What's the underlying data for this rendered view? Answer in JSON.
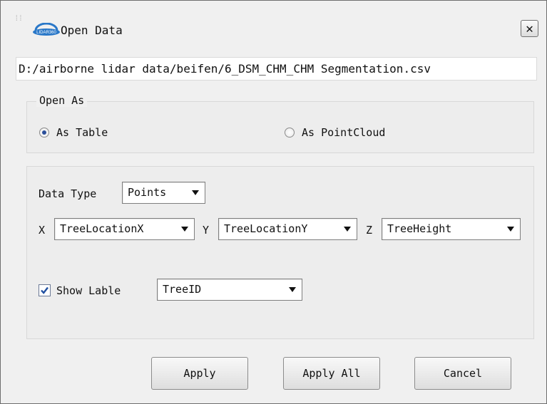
{
  "dialog": {
    "title": "Open Data",
    "close_label": "✕",
    "app_logo_text": "LIDAR360"
  },
  "file_path": "D:/airborne lidar data/beifen/6_DSM_CHM_CHM Segmentation.csv",
  "open_as": {
    "legend": "Open As",
    "options": [
      {
        "label": "As Table",
        "selected": true
      },
      {
        "label": "As PointCloud",
        "selected": false
      }
    ]
  },
  "data_section": {
    "data_type_label": "Data Type",
    "data_type_value": "Points",
    "x_label": "X",
    "x_value": "TreeLocationX",
    "y_label": "Y",
    "y_value": "TreeLocationY",
    "z_label": "Z",
    "z_value": "TreeHeight",
    "show_label_checked": true,
    "show_label_text": "Show Lable",
    "label_field_value": "TreeID"
  },
  "buttons": {
    "apply": "Apply",
    "apply_all": "Apply All",
    "cancel": "Cancel"
  },
  "colors": {
    "radio_dot": "#2b4f9a",
    "checkbox_mark": "#1f4fa0"
  }
}
